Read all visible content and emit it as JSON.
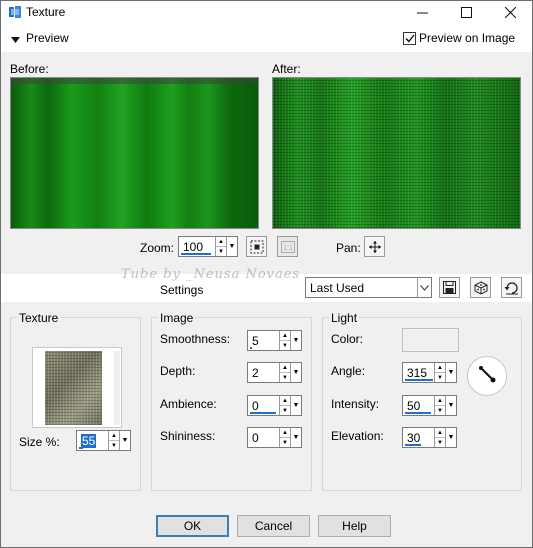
{
  "window": {
    "title": "Texture",
    "minimize_icon": "minimize-icon",
    "maximize_icon": "maximize-icon",
    "close_icon": "close-icon"
  },
  "preview_header": {
    "label": "Preview",
    "preview_on_image_label": "Preview on Image",
    "preview_on_image_checked": true
  },
  "preview": {
    "before_label": "Before:",
    "after_label": "After:",
    "zoom_label": "Zoom:",
    "zoom_value": "100",
    "pan_label": "Pan:"
  },
  "watermark": "Tube by _Neusa Novaes",
  "settings": {
    "label": "Settings",
    "preset_value": "Last Used"
  },
  "texture_group": {
    "title": "Texture",
    "size_label": "Size %:",
    "size_value": "55"
  },
  "image_group": {
    "title": "Image",
    "smoothness_label": "Smoothness:",
    "smoothness_value": "5",
    "depth_label": "Depth:",
    "depth_value": "2",
    "ambience_label": "Ambience:",
    "ambience_value": "0",
    "shininess_label": "Shininess:",
    "shininess_value": "0"
  },
  "light_group": {
    "title": "Light",
    "color_label": "Color:",
    "color_value": "#f0f0f0",
    "angle_label": "Angle:",
    "angle_value": "315",
    "intensity_label": "Intensity:",
    "intensity_value": "50",
    "elevation_label": "Elevation:",
    "elevation_value": "30"
  },
  "buttons": {
    "ok": "OK",
    "cancel": "Cancel",
    "help": "Help"
  }
}
